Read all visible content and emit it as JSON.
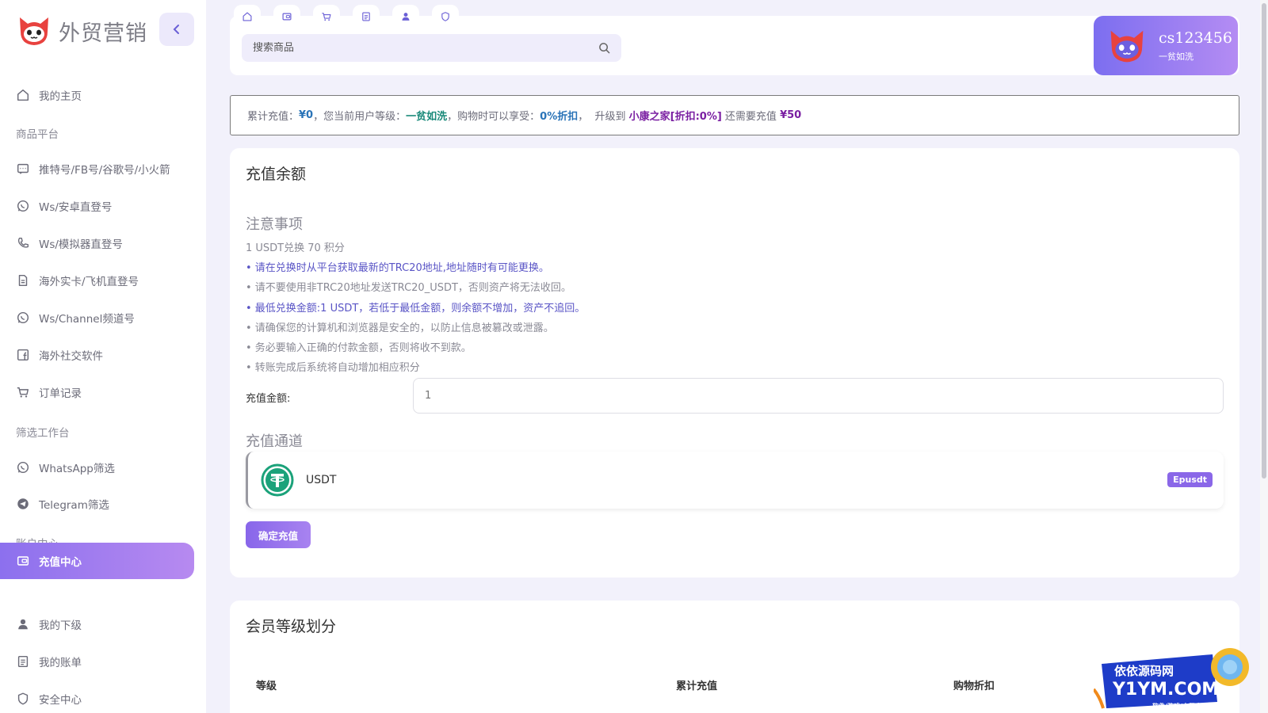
{
  "brand": {
    "name": "外贸营销"
  },
  "sidebar": {
    "items": [
      {
        "type": "item",
        "label": "我的主页",
        "icon": "home-icon"
      },
      {
        "type": "section",
        "label": "商品平台"
      },
      {
        "type": "item",
        "label": "推特号/FB号/谷歌号/小火箭",
        "icon": "message-icon"
      },
      {
        "type": "item",
        "label": "Ws/安卓直登号",
        "icon": "whatsapp-icon"
      },
      {
        "type": "item",
        "label": "Ws/模拟器直登号",
        "icon": "phone-icon"
      },
      {
        "type": "item",
        "label": "海外实卡/飞机直登号",
        "icon": "document-icon"
      },
      {
        "type": "item",
        "label": "Ws/Channel频道号",
        "icon": "whatsapp-icon"
      },
      {
        "type": "item",
        "label": "海外社交软件",
        "icon": "facebook-icon"
      },
      {
        "type": "item",
        "label": "订单记录",
        "icon": "cart-icon"
      },
      {
        "type": "section",
        "label": "筛选工作台"
      },
      {
        "type": "item",
        "label": "WhatsApp筛选",
        "icon": "whatsapp-icon"
      },
      {
        "type": "item",
        "label": "Telegram筛选",
        "icon": "telegram-icon"
      },
      {
        "type": "section",
        "label": "账户中心"
      },
      {
        "type": "item",
        "label": "充值中心",
        "icon": "wallet-icon",
        "active": true
      },
      {
        "type": "item",
        "label": "我的下级",
        "icon": "user-icon"
      },
      {
        "type": "item",
        "label": "我的账单",
        "icon": "bill-icon"
      },
      {
        "type": "item",
        "label": "安全中心",
        "icon": "shield-icon"
      }
    ]
  },
  "topbar": {
    "quick_icons": [
      "home-icon",
      "wallet-icon",
      "cart-icon",
      "bill-icon",
      "user-icon",
      "shield-icon"
    ],
    "search_placeholder": "搜索商品"
  },
  "user": {
    "name": "cs123456",
    "level": "一贫如洗"
  },
  "notice": {
    "total_label": "累计充值：",
    "total_value": "¥0",
    "level_label": "，您当前用户等级：",
    "level_value": "一贫如洗",
    "discount_label": "，购物时可以享受：",
    "discount_value": "0%折扣",
    "upgrade_label": "，  升级到 ",
    "upgrade_value": "小康之家[折扣:0%]",
    "need_label": " 还需要充值 ",
    "need_value": "¥50"
  },
  "recharge": {
    "title": "充值余额",
    "notes_title": "注意事项",
    "rate": "1 USDT兑换 70 积分",
    "notes": [
      "• 请在兑换时从平台获取最新的TRC20地址,地址随时有可能更换。",
      "• 请不要使用非TRC20地址发送TRC20_USDT，否则资产将无法收回。",
      "• 最低兑换金额:1 USDT，若低于最低金额，则余额不增加，资产不追回。",
      "• 请确保您的计算机和浏览器是安全的，以防止信息被篡改或泄露。",
      "• 务必要输入正确的付款金额，否则将收不到款。",
      "• 转账完成后系统将自动增加相应积分"
    ],
    "amount_label": "充值金额:",
    "amount_placeholder": "1",
    "channel_title": "充值通道",
    "channel_name": "USDT",
    "channel_badge": "Epusdt",
    "submit": "确定充值"
  },
  "member": {
    "title": "会员等级划分",
    "columns": [
      "等级",
      "累计充值",
      "购物折扣"
    ]
  },
  "watermark": {
    "line1": "依依源码网",
    "line2": "Y1YM.COM",
    "line3": "软件/游戏/小程序/棋牌"
  },
  "colors": {
    "accent": "#8c70ee",
    "accent_light": "#b78af0",
    "background": "#f2f1fb"
  }
}
